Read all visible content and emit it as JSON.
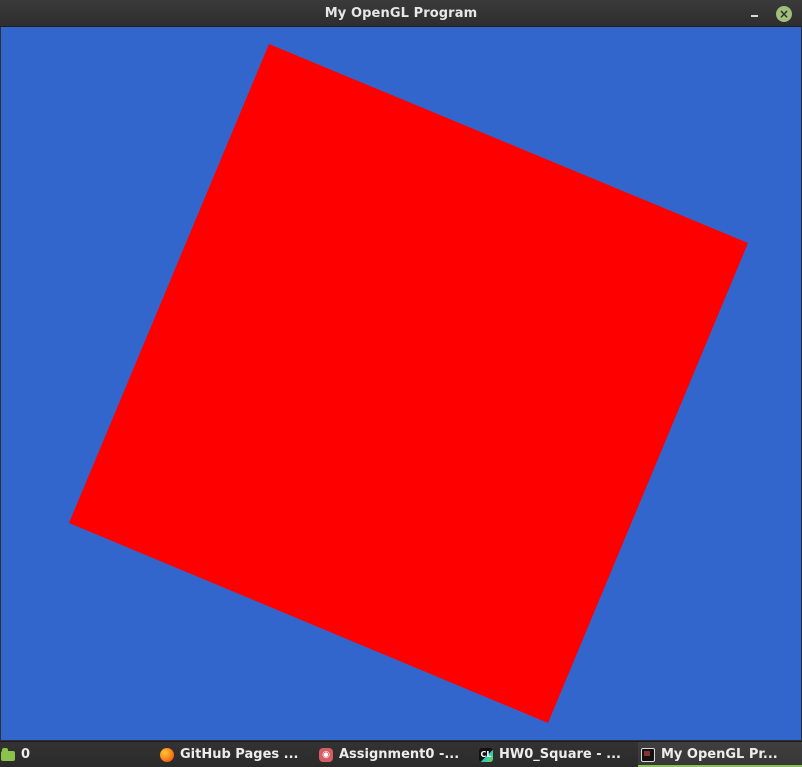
{
  "window": {
    "title": "My OpenGL Program",
    "minimize_icon": "minimize-icon",
    "close_icon": "close-icon",
    "close_symbol": "×"
  },
  "canvas": {
    "background_color": "#3366cc",
    "shape": {
      "type": "rotated-square",
      "fill_color": "#ff0000"
    }
  },
  "taskbar": {
    "tasks": [
      {
        "label": "0",
        "icon": "folder-icon"
      },
      {
        "label": "GitHub Pages ...",
        "icon": "firefox-icon"
      },
      {
        "label": "Assignment0 -...",
        "icon": "app-icon"
      },
      {
        "label": "HW0_Square - ...",
        "icon": "clion-icon",
        "icon_text": "CL"
      },
      {
        "label": "My OpenGL Pr...",
        "icon": "terminal-icon",
        "active": true
      }
    ]
  }
}
